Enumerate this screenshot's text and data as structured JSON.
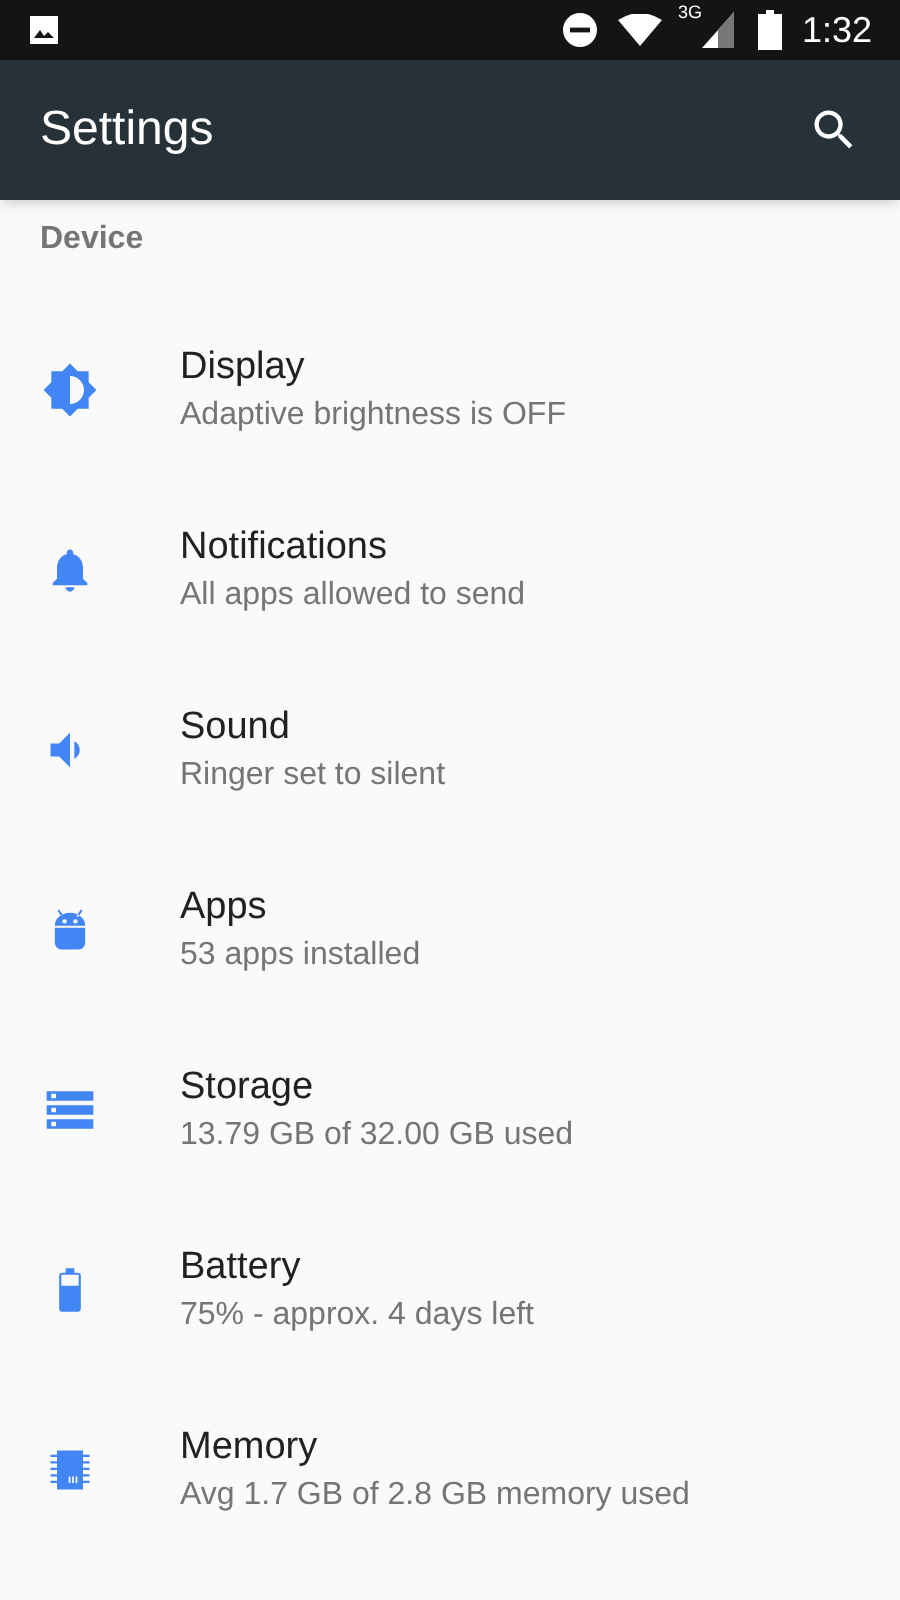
{
  "status_bar": {
    "time": "1:32",
    "network": "3G"
  },
  "app_bar": {
    "title": "Settings"
  },
  "section": {
    "title": "Device"
  },
  "items": [
    {
      "kind": "display",
      "title": "Display",
      "summary": "Adaptive brightness is OFF"
    },
    {
      "kind": "notifications",
      "title": "Notifications",
      "summary": "All apps allowed to send"
    },
    {
      "kind": "sound",
      "title": "Sound",
      "summary": "Ringer set to silent"
    },
    {
      "kind": "apps",
      "title": "Apps",
      "summary": "53 apps installed"
    },
    {
      "kind": "storage",
      "title": "Storage",
      "summary": "13.79 GB of 32.00 GB used"
    },
    {
      "kind": "battery",
      "title": "Battery",
      "summary": "75% - approx. 4 days left"
    },
    {
      "kind": "memory",
      "title": "Memory",
      "summary": "Avg 1.7 GB of 2.8 GB memory used"
    }
  ]
}
